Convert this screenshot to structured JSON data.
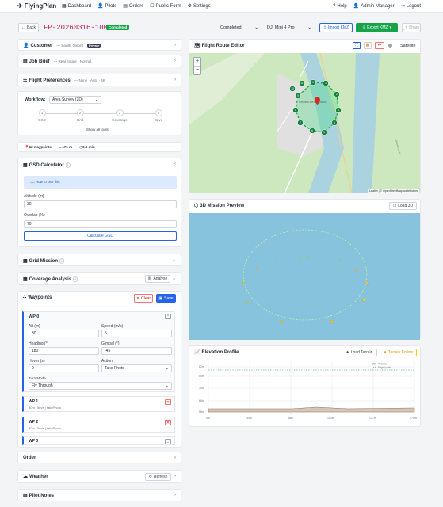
{
  "nav": {
    "brand": "FlyingPlan",
    "links": [
      "Dashboard",
      "Pilots",
      "Orders",
      "Public Form",
      "Settings"
    ],
    "right": [
      "Help",
      "Admin Manager",
      "Logout"
    ]
  },
  "header": {
    "back": "Back",
    "job_id": "FP-20260316-1009",
    "badge": "Completed",
    "status": "Completed",
    "drone": "DJI Mini 4 Pro",
    "import": "Import KMZ",
    "export": "Export KMZ",
    "share": "Share"
  },
  "customer": {
    "title": "Customer",
    "name": "— Savills Oxford",
    "tag": "Private"
  },
  "job_brief": {
    "title": "Job Brief",
    "sub": "— Real Estate · Normal"
  },
  "flight_prefs": {
    "title": "Flight Preferences",
    "sub": "— None · Auto · 4K"
  },
  "workflow": {
    "label": "Workflow:",
    "value": "Area Survey (2D)",
    "steps": [
      {
        "n": "1",
        "label": "GSD"
      },
      {
        "n": "2",
        "label": "Grid"
      },
      {
        "n": "3",
        "label": "Coverage"
      },
      {
        "n": "4",
        "label": "Save"
      }
    ],
    "show_all": "Show all tools"
  },
  "stats": {
    "waypoints": "12 waypoints",
    "distance": "171 m",
    "time": "0.6 min"
  },
  "gsd": {
    "title": "GSD Calculator",
    "how": "How to use this",
    "altitude_label": "Altitude (m)",
    "altitude": "30",
    "overlap_label": "Overlap (%)",
    "overlap": "70",
    "calc": "Calculate GSD"
  },
  "grid": {
    "title": "Grid Mission"
  },
  "coverage": {
    "title": "Coverage Analysis",
    "analyse": "Analyse"
  },
  "waypoints": {
    "title": "Waypoints",
    "clear": "Clear",
    "save": "Save"
  },
  "wp0": {
    "name": "WP 0",
    "alt_label": "Alt (m)",
    "alt": "30",
    "speed_label": "Speed (m/s)",
    "speed": "5",
    "heading_label": "Heading (°)",
    "heading": "180",
    "gimbal_label": "Gimbal (°)",
    "gimbal": "-45",
    "hover_label": "Hover (s)",
    "hover": "0",
    "action_label": "Action",
    "action": "Take Photo",
    "turn_label": "Turn Mode",
    "turn": "Fly Through"
  },
  "wp1": {
    "name": "WP 1",
    "desc": "30m | 5m/s | takePhoto"
  },
  "wp2": {
    "name": "WP 2",
    "desc": "30m | 5m/s | takePhoto"
  },
  "wp3": {
    "name": "WP 3"
  },
  "order": {
    "title": "Order"
  },
  "weather": {
    "title": "Weather",
    "refresh": "Refresh"
  },
  "notes": {
    "title": "Pilot Notes"
  },
  "map": {
    "title": "Flight Route Editor",
    "satellite": "Satellite",
    "zoom_in": "+",
    "zoom_out": "−",
    "attribution": "Leaflet | © OpenStreetMap contributors",
    "place": "OXFORD CITY COUNCIL",
    "waypoint_numbers": [
      "0",
      "1",
      "2",
      "3",
      "4",
      "5",
      "6",
      "7",
      "8",
      "9",
      "10",
      "11"
    ]
  },
  "preview": {
    "title": "3D Mission Preview",
    "load": "Load 3D"
  },
  "elevation": {
    "title": "Elevation Profile",
    "load_terrain": "Load Terrain",
    "terrain_follow": "Terrain Follow",
    "legend": [
      "Terrain",
      "Flight path"
    ],
    "yticks": [
      "62m",
      "50m",
      "74m",
      "66m",
      "58m"
    ],
    "xticks": [
      "0m",
      "34m",
      "68m",
      "103m",
      "137m",
      "171m"
    ]
  },
  "colors": {
    "accent": "#2563eb",
    "green": "#16a34a",
    "map_water": "#aad3df",
    "map_green": "#cde8bf",
    "sky": "#87c3dc"
  }
}
